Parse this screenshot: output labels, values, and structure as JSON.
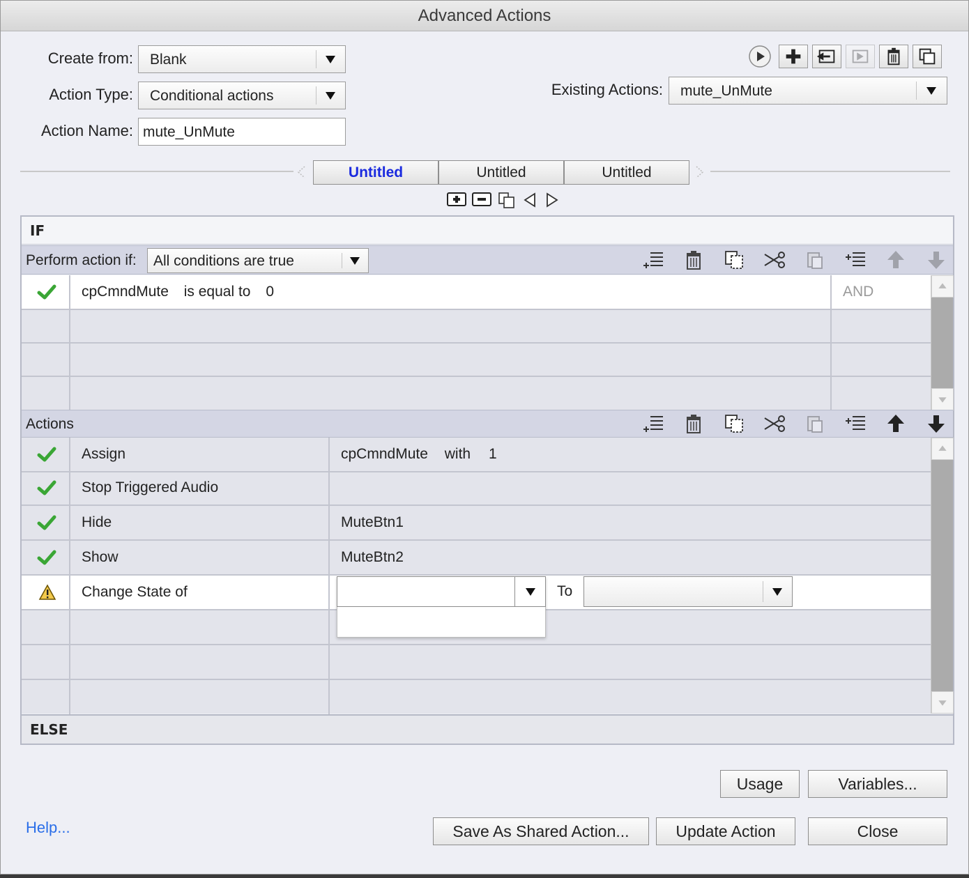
{
  "window": {
    "title": "Advanced Actions"
  },
  "form": {
    "create_from_label": "Create from:",
    "create_from_value": "Blank",
    "action_type_label": "Action Type:",
    "action_type_value": "Conditional actions",
    "action_name_label": "Action Name:",
    "action_name_value": "mute_UnMute",
    "existing_actions_label": "Existing Actions:",
    "existing_actions_value": "mute_UnMute"
  },
  "tabs": [
    {
      "label": "Untitled",
      "active": true
    },
    {
      "label": "Untitled",
      "active": false
    },
    {
      "label": "Untitled",
      "active": false
    }
  ],
  "if_section": {
    "header": "IF",
    "perform_label": "Perform action if:",
    "perform_value": "All conditions are true",
    "conditions": [
      {
        "status": "ok",
        "variable": "cpCmndMute",
        "operator": "is equal to",
        "value": "0",
        "join": "AND"
      }
    ]
  },
  "actions_section": {
    "header": "Actions",
    "rows": [
      {
        "status": "ok",
        "action": "Assign",
        "target": "cpCmndMute",
        "extra": "with",
        "value": "1"
      },
      {
        "status": "ok",
        "action": "Stop Triggered Audio",
        "target": ""
      },
      {
        "status": "ok",
        "action": "Hide",
        "target": "MuteBtn1"
      },
      {
        "status": "ok",
        "action": "Show",
        "target": "MuteBtn2"
      },
      {
        "status": "warning",
        "action": "Change State of",
        "target": "",
        "to_label": "To"
      }
    ]
  },
  "else_section": {
    "header": "ELSE"
  },
  "buttons": {
    "usage": "Usage",
    "variables": "Variables...",
    "help": "Help...",
    "save_shared": "Save As Shared Action...",
    "update": "Update Action",
    "close": "Close"
  },
  "colors": {
    "accent_tab": "#1a2adf",
    "check_green": "#3aa635",
    "warning_yellow": "#f2c94c",
    "link_blue": "#2a6ee8"
  }
}
